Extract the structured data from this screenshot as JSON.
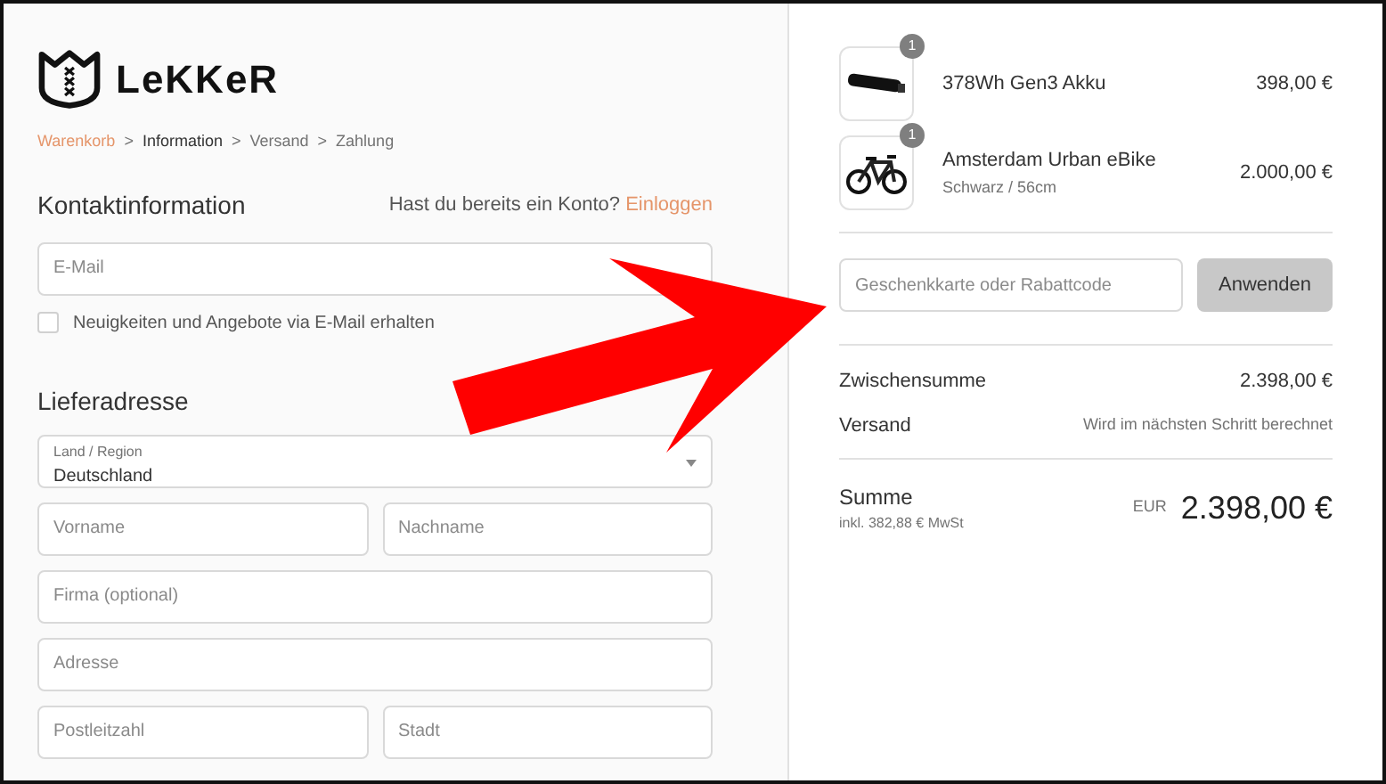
{
  "brand": {
    "name": "LeKKeR"
  },
  "breadcrumb": [
    {
      "label": "Warenkorb",
      "kind": "link"
    },
    {
      "label": "Information",
      "kind": "current"
    },
    {
      "label": "Versand",
      "kind": "step"
    },
    {
      "label": "Zahlung",
      "kind": "step"
    }
  ],
  "breadcrumb_separator": ">",
  "contact": {
    "title": "Kontaktinformation",
    "account_prompt": "Hast du bereits ein Konto?",
    "login_link": "Einloggen",
    "email_placeholder": "E-Mail",
    "newsletter": {
      "label": "Neuigkeiten und Angebote via E-Mail erhalten",
      "checked": false
    }
  },
  "shipping": {
    "title": "Lieferadresse",
    "country": {
      "label": "Land / Region",
      "value": "Deutschland"
    },
    "fields": [
      [
        {
          "placeholder": "Vorname"
        },
        {
          "placeholder": "Nachname"
        }
      ],
      [
        {
          "placeholder": "Firma (optional)"
        }
      ],
      [
        {
          "placeholder": "Adresse"
        }
      ],
      [
        {
          "placeholder": "Postleitzahl"
        },
        {
          "placeholder": "Stadt"
        }
      ]
    ]
  },
  "cart": {
    "items": [
      {
        "kind": "battery",
        "quantity": "1",
        "name": "378Wh Gen3 Akku",
        "price": "398,00 €"
      },
      {
        "kind": "bike",
        "quantity": "1",
        "name": "Amsterdam Urban eBike",
        "variant": "Schwarz / 56cm",
        "price": "2.000,00 €"
      }
    ],
    "discount": {
      "placeholder": "Geschenkkarte oder Rabattcode",
      "button": "Anwenden"
    },
    "lines": [
      {
        "label": "Zwischensumme",
        "value": "2.398,00 €",
        "kind": "amount"
      },
      {
        "label": "Versand",
        "value": "Wird im nächsten Schritt berechnet",
        "kind": "note"
      }
    ],
    "total": {
      "label": "Summe",
      "tax": "inkl. 382,88 € MwSt",
      "currency": "EUR",
      "value": "2.398,00 €"
    }
  },
  "annotation": {
    "kind": "arrow"
  }
}
